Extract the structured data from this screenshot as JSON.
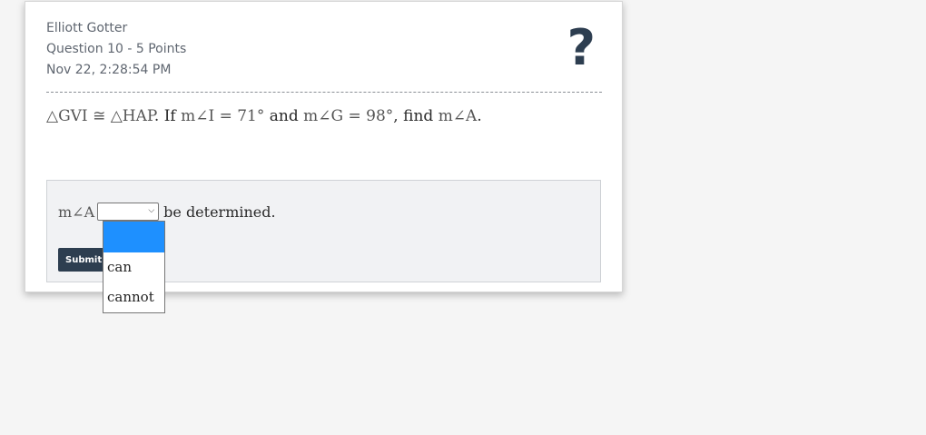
{
  "header": {
    "student_name": "Elliott Gotter",
    "question_info": "Question 10 - 5 Points",
    "timestamp": "Nov 22, 2:28:54 PM",
    "help_icon": "?"
  },
  "question": {
    "tri1": "△GVI",
    "congruent": "≅",
    "tri2": "△HAP",
    "text_if": ". If ",
    "angle_i": "m∠I = 71°",
    "text_and": " and ",
    "angle_g": "m∠G = 98°",
    "text_find": ", find ",
    "angle_a": "m∠A",
    "text_end": "."
  },
  "answer": {
    "prefix": "m∠A",
    "selected_value": "",
    "suffix": "be determined.",
    "submit_label": "Submit Answer",
    "options": [
      "",
      "can",
      "cannot"
    ]
  },
  "colors": {
    "accent": "#2d3e50",
    "highlight": "#1e90ff"
  }
}
